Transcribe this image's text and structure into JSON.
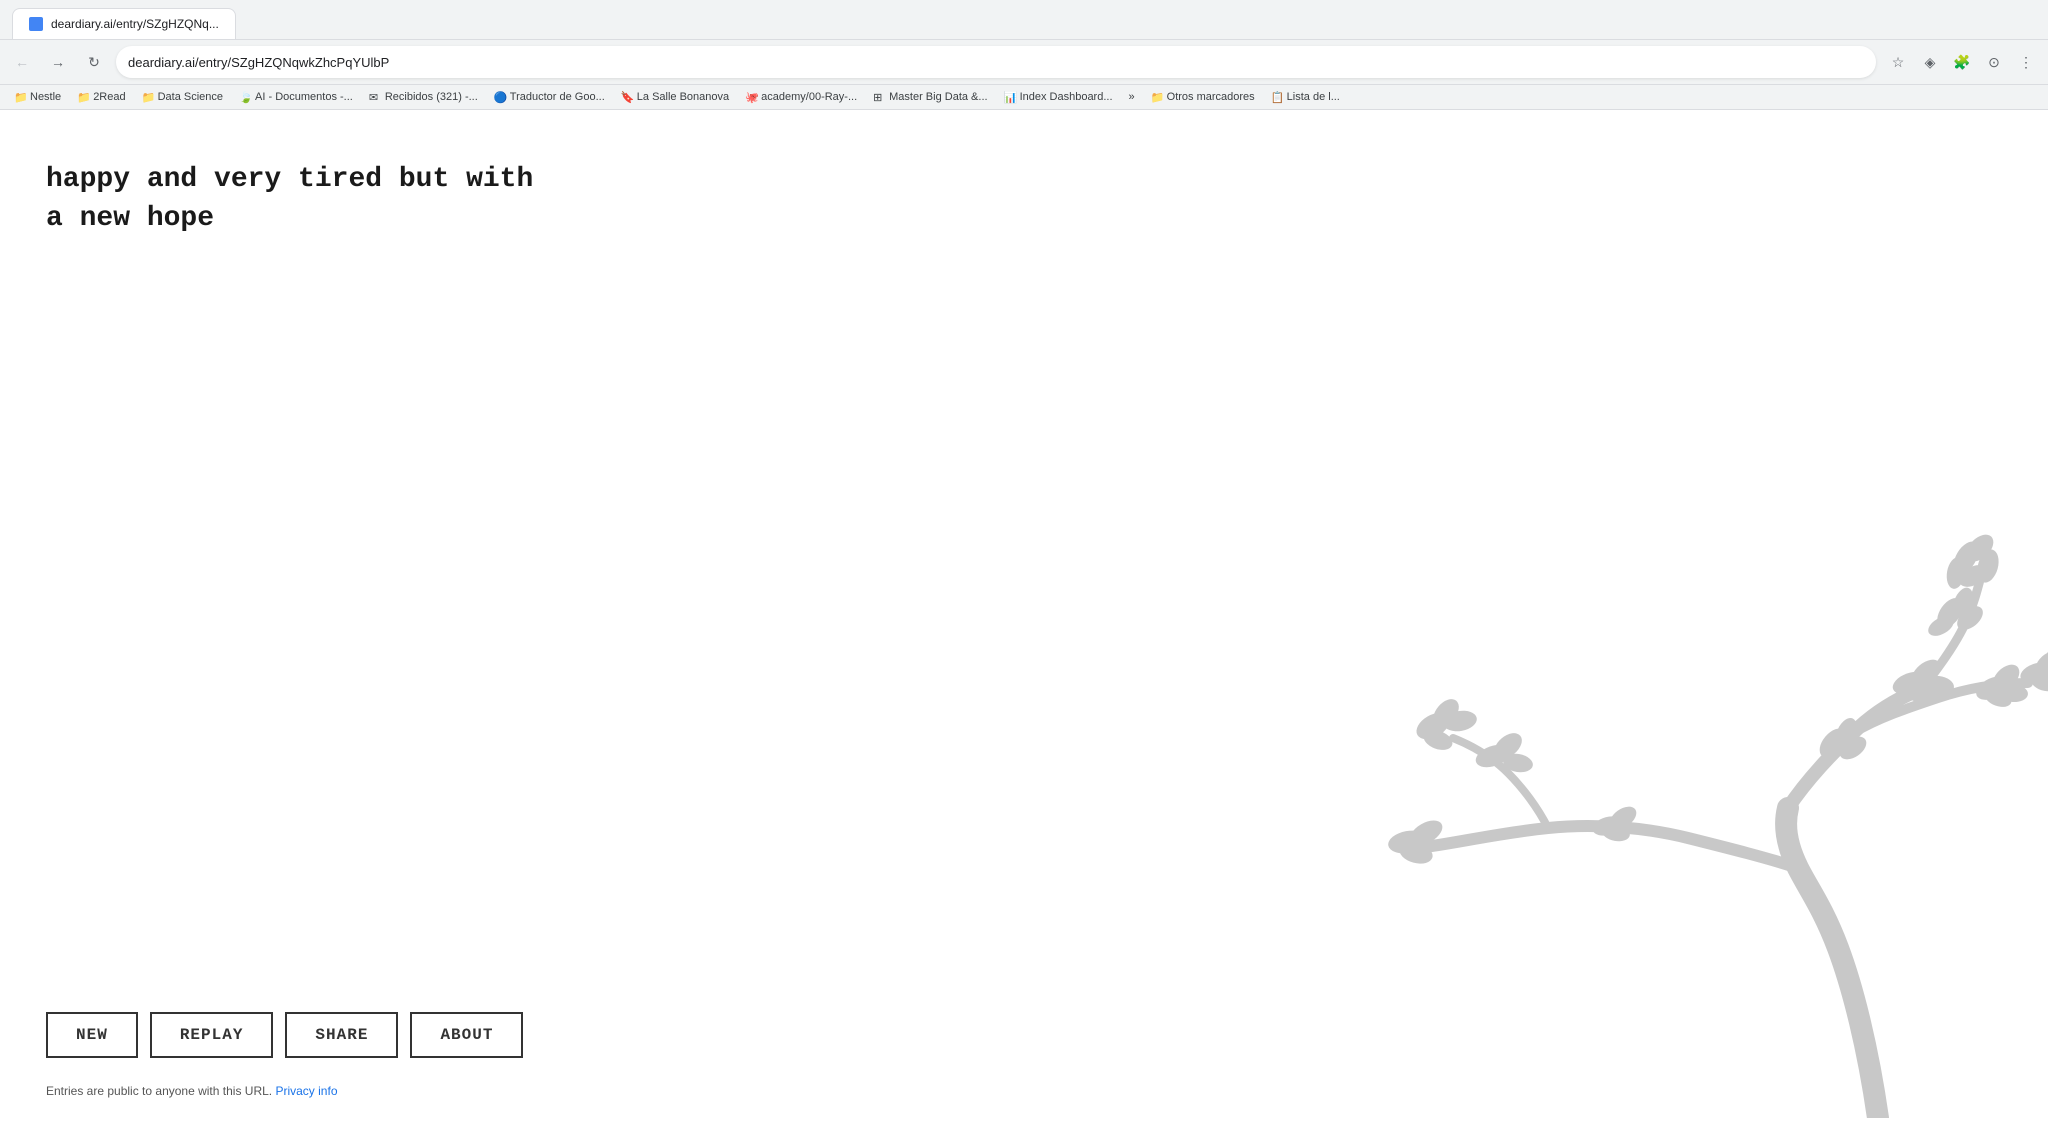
{
  "browser": {
    "url": "deardiary.ai/entry/SZgHZQNqwkZhcPqYUlbP",
    "tab_title": "deardiary.ai/entry/SZgHZQNq...",
    "bookmarks": [
      {
        "label": "Nestle",
        "icon": "📁"
      },
      {
        "label": "2Read",
        "icon": "📁"
      },
      {
        "label": "Data Science",
        "icon": "📁"
      },
      {
        "label": "AI - Documentos -...",
        "icon": "🍃"
      },
      {
        "label": "Recibidos (321) -...",
        "icon": "✉"
      },
      {
        "label": "Traductor de Goo...",
        "icon": "🔵"
      },
      {
        "label": "La Salle Bonanova",
        "icon": "🔖"
      },
      {
        "label": "academy/00-Ray-...",
        "icon": "🐙"
      },
      {
        "label": "Master Big Data &...",
        "icon": "⊞"
      },
      {
        "label": "Index Dashboard...",
        "icon": "📊"
      },
      {
        "label": "»",
        "icon": ""
      },
      {
        "label": "Otros marcadores",
        "icon": "📁"
      },
      {
        "label": "Lista de l...",
        "icon": "📋"
      }
    ]
  },
  "page": {
    "diary_line1": "happy and very tired but with",
    "diary_line2": "a new hope"
  },
  "buttons": {
    "new_label": "NEW",
    "replay_label": "REPLAY",
    "share_label": "SHARE",
    "about_label": "about"
  },
  "footer": {
    "text": "Entries are public to anyone with this URL.",
    "link_text": "Privacy info"
  },
  "colors": {
    "tree_color": "#c8c8c8",
    "button_border": "#333333",
    "text_color": "#1a1a1a",
    "accent_blue": "#1a73e8"
  }
}
